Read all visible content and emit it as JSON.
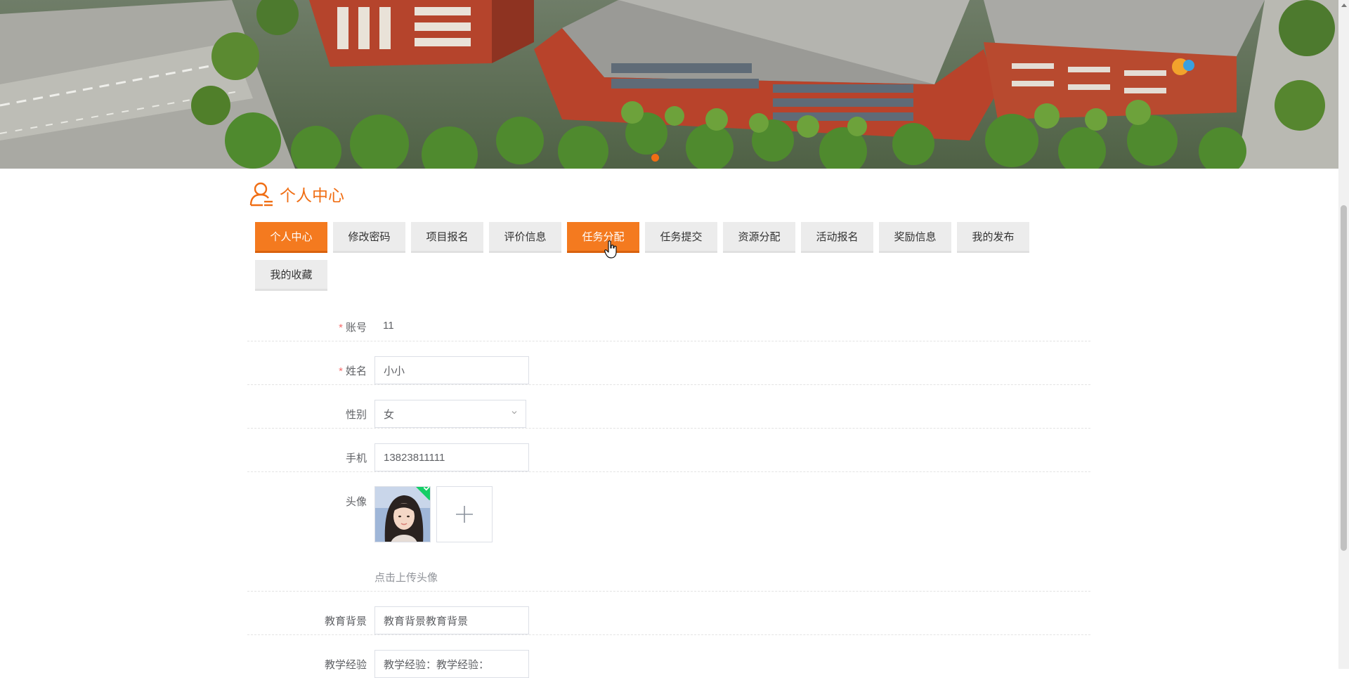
{
  "page_title": "个人中心",
  "tabs": [
    {
      "label": "个人中心",
      "active": true
    },
    {
      "label": "修改密码",
      "active": false
    },
    {
      "label": "项目报名",
      "active": false
    },
    {
      "label": "评价信息",
      "active": false
    },
    {
      "label": "任务分配",
      "active": true
    },
    {
      "label": "任务提交",
      "active": false
    },
    {
      "label": "资源分配",
      "active": false
    },
    {
      "label": "活动报名",
      "active": false
    },
    {
      "label": "奖励信息",
      "active": false
    },
    {
      "label": "我的发布",
      "active": false
    },
    {
      "label": "我的收藏",
      "active": false
    }
  ],
  "form": {
    "account": {
      "label": "账号",
      "required_mark": "*",
      "value": "11"
    },
    "name": {
      "label": "姓名",
      "required_mark": "*",
      "value": "小小"
    },
    "gender": {
      "label": "性别",
      "value": "女"
    },
    "phone": {
      "label": "手机",
      "value": "13823811111"
    },
    "avatar": {
      "label": "头像",
      "hint": "点击上传头像"
    },
    "education": {
      "label": "教育背景",
      "value": "教育背景教育背景"
    },
    "experience": {
      "label": "教学经验",
      "value": "教学经验：教学经验："
    }
  },
  "colors": {
    "accent": "#f47a1f",
    "tab_bg": "#ececec",
    "required": "#f56c6c",
    "success": "#13ce66"
  },
  "icons": {
    "heading": "user-icon",
    "upload": "plus-icon",
    "select": "chevron-down-icon",
    "uploaded": "check-icon"
  }
}
